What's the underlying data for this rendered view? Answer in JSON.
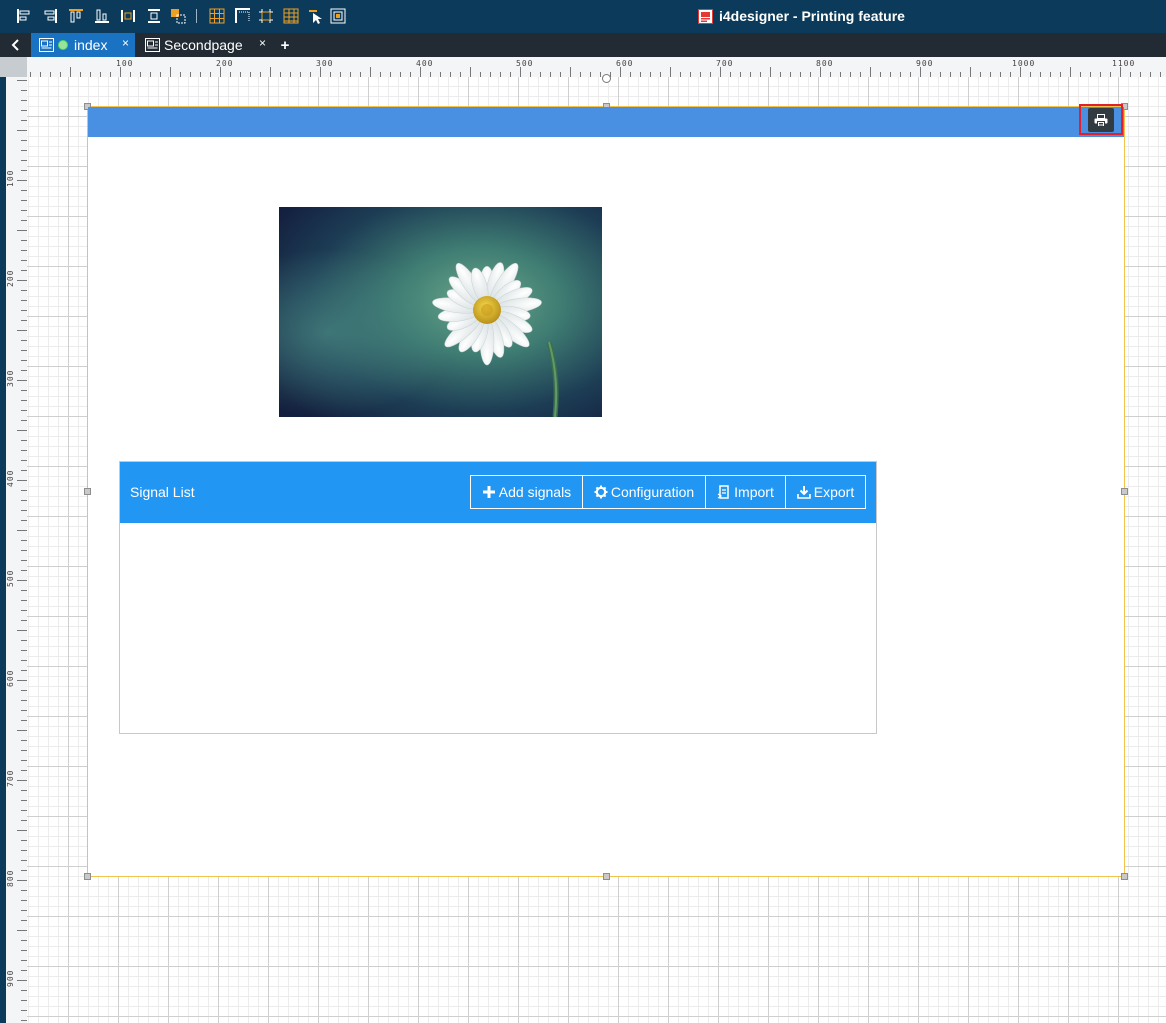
{
  "app": {
    "title": "i4designer - Printing feature"
  },
  "tabs": [
    {
      "label": "index",
      "close": "×",
      "active": true
    },
    {
      "label": "Secondpage",
      "close": "×",
      "active": false
    }
  ],
  "tab_add_label": "+",
  "ruler": {
    "top": [
      "100",
      "200",
      "300",
      "400",
      "500",
      "600",
      "700",
      "800",
      "900",
      "1000",
      "1100"
    ],
    "left": [
      "100",
      "200",
      "300",
      "400",
      "500",
      "600",
      "700",
      "800",
      "900"
    ]
  },
  "page_header": {
    "color": "#4a90e2",
    "print_icon": "printer-icon"
  },
  "signal_list": {
    "title": "Signal List",
    "buttons": {
      "add": "Add signals",
      "configuration": "Configuration",
      "import": "Import",
      "export": "Export"
    },
    "header_color": "#2196f3"
  },
  "colors": {
    "topbar": "#0b3a5a",
    "tab_active": "#1a73c2",
    "selection": "#e0202a"
  }
}
